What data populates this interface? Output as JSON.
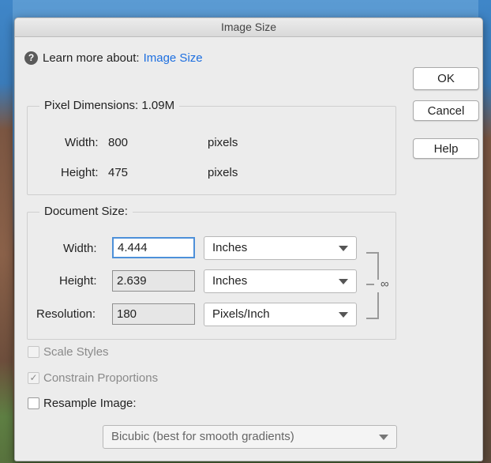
{
  "dialog": {
    "title": "Image Size",
    "learn_prefix": "Learn more about:",
    "learn_link": "Image Size"
  },
  "buttons": {
    "ok": "OK",
    "cancel": "Cancel",
    "help": "Help"
  },
  "pixel_dimensions": {
    "title": "Pixel Dimensions:  1.09M",
    "width_label": "Width:",
    "width_value": "800",
    "width_unit": "pixels",
    "height_label": "Height:",
    "height_value": "475",
    "height_unit": "pixels"
  },
  "document_size": {
    "title": "Document Size:",
    "width_label": "Width:",
    "width_value": "4.444",
    "width_unit": "Inches",
    "height_label": "Height:",
    "height_value": "2.639",
    "height_unit": "Inches",
    "resolution_label": "Resolution:",
    "resolution_value": "180",
    "resolution_unit": "Pixels/Inch"
  },
  "options": {
    "scale_styles": "Scale Styles",
    "constrain_proportions": "Constrain Proportions",
    "resample_image": "Resample Image:",
    "resample_method": "Bicubic (best for smooth gradients)"
  },
  "icons": {
    "help": "question-circle-icon",
    "chain": "chain-link-icon",
    "dropdown": "chevron-down-icon",
    "check": "checkmark-icon"
  }
}
